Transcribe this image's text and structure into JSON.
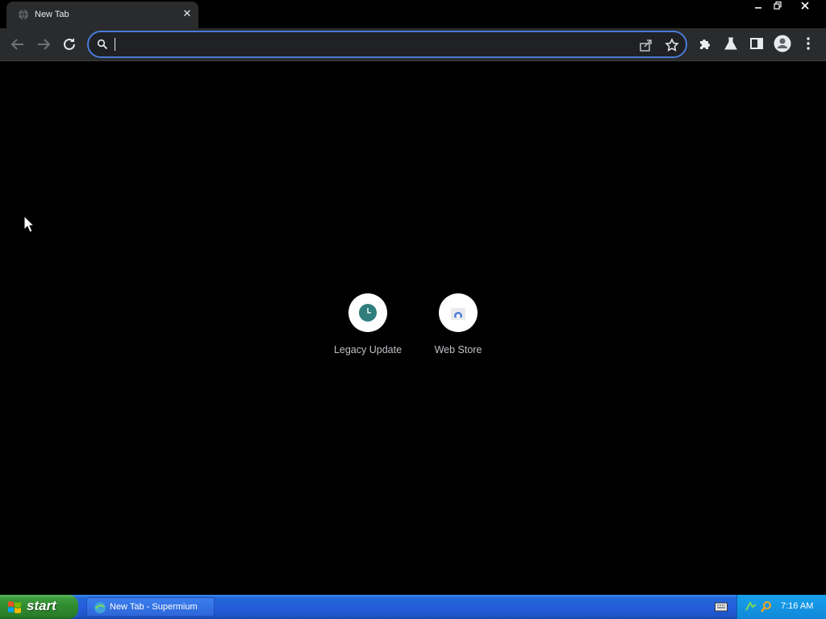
{
  "browser": {
    "tab": {
      "title": "New Tab",
      "close": "✕"
    },
    "window_controls": {
      "minimize": "—",
      "restore": "❐",
      "close": "✕"
    },
    "omnibox": {
      "value": "",
      "placeholder": ""
    }
  },
  "content": {
    "shortcuts": [
      {
        "label": "Legacy Update",
        "icon": "legacy-update-icon"
      },
      {
        "label": "Web Store",
        "icon": "web-store-icon"
      }
    ]
  },
  "taskbar": {
    "start_label": "start",
    "task_item_label": "New Tab - Supermium",
    "clock": "7:16 AM"
  },
  "colors": {
    "accent": "#4a7bd9",
    "tab_bg": "#2a2b2d",
    "taskbar": "#245edb",
    "start_green": "#2f8a2f"
  }
}
